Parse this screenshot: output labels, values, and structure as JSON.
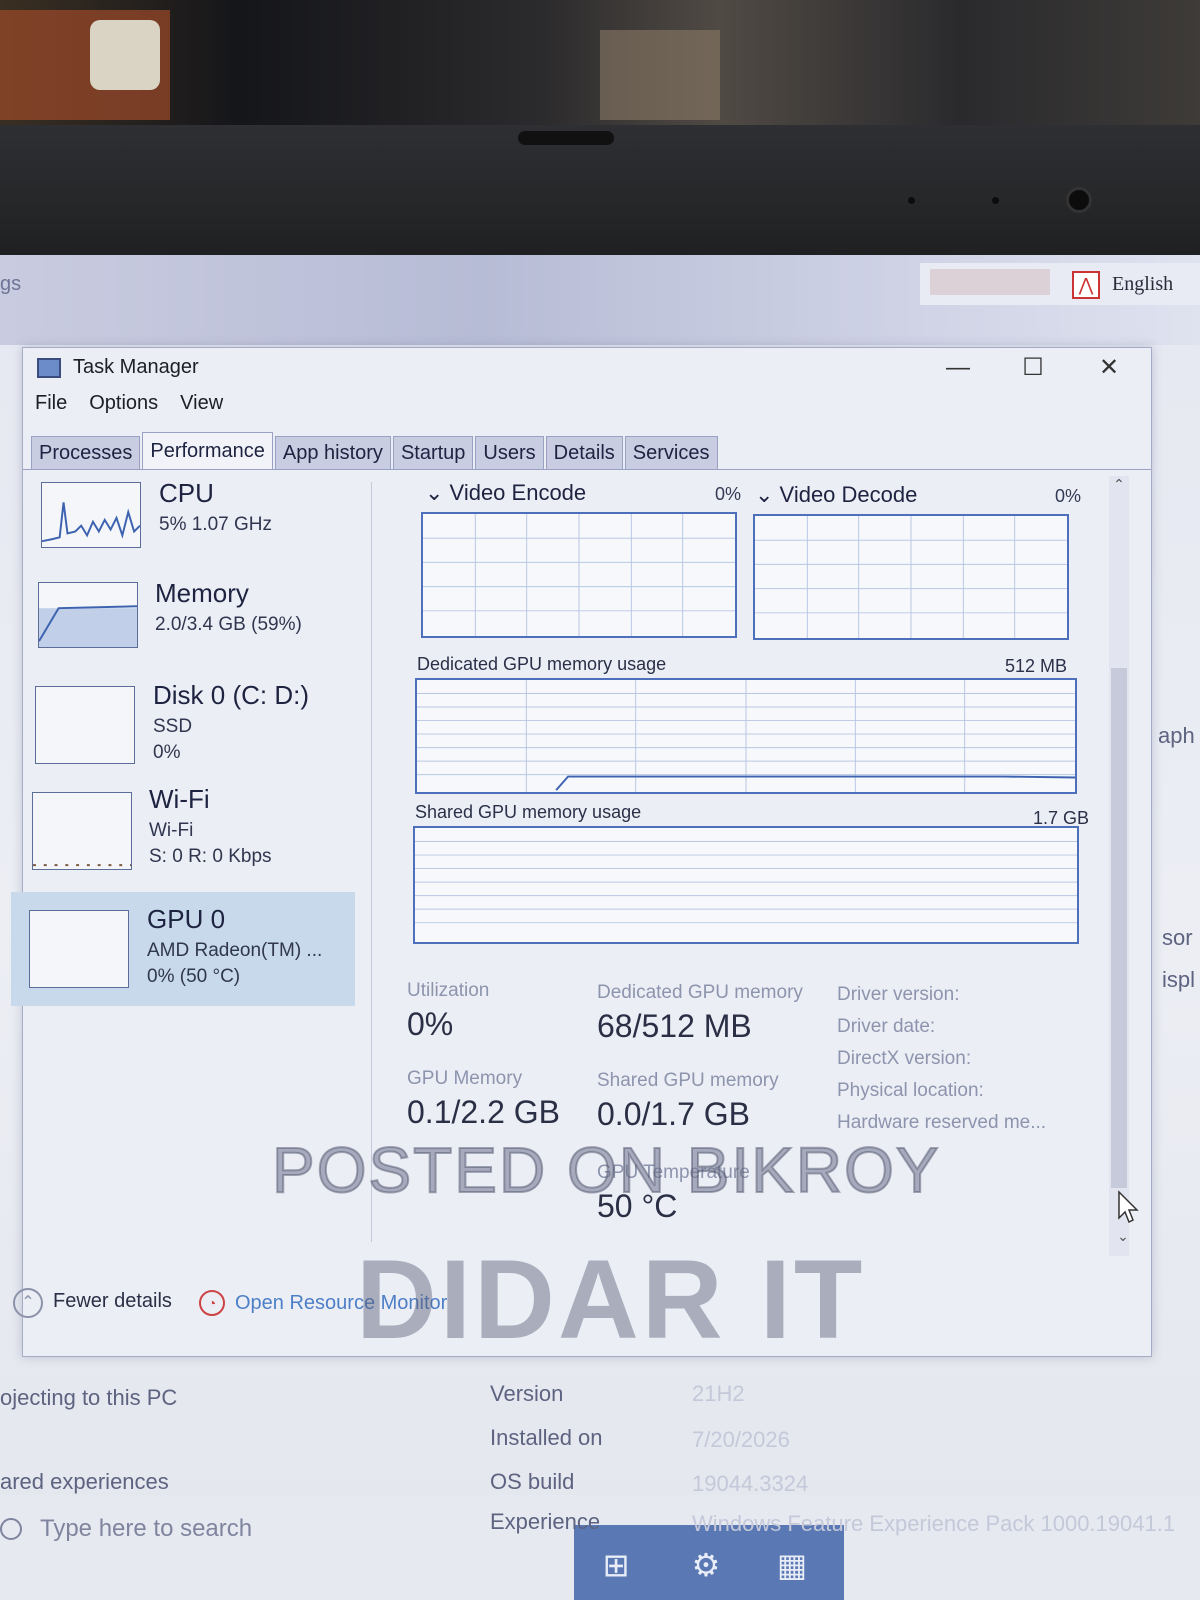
{
  "window": {
    "title": "Task Manager",
    "controls": {
      "minimize": "—",
      "maximize": "☐",
      "close": "✕"
    }
  },
  "menu": [
    "File",
    "Options",
    "View"
  ],
  "tabs": [
    "Processes",
    "Performance",
    "App history",
    "Startup",
    "Users",
    "Details",
    "Services"
  ],
  "active_tab": "Performance",
  "sidebar": [
    {
      "name": "CPU",
      "line1": "5%  1.07 GHz",
      "line2": ""
    },
    {
      "name": "Memory",
      "line1": "2.0/3.4 GB (59%)",
      "line2": ""
    },
    {
      "name": "Disk 0 (C: D:)",
      "line1": "SSD",
      "line2": "0%"
    },
    {
      "name": "Wi-Fi",
      "line1": "Wi-Fi",
      "line2": "S: 0  R: 0 Kbps"
    },
    {
      "name": "GPU 0",
      "line1": "AMD Radeon(TM) ...",
      "line2": "0% (50 °C)"
    }
  ],
  "graphs": {
    "video_encode": {
      "label": "Video Encode",
      "pct": "0%"
    },
    "video_decode": {
      "label": "Video Decode",
      "pct": "0%"
    },
    "dedicated": {
      "label": "Dedicated GPU memory usage",
      "max": "512 MB"
    },
    "shared": {
      "label": "Shared GPU memory usage",
      "max": "1.7 GB"
    }
  },
  "stats": {
    "utilization": {
      "label": "Utilization",
      "value": "0%"
    },
    "dedicated_mem": {
      "label": "Dedicated GPU memory",
      "value": "68/512 MB"
    },
    "gpu_memory": {
      "label": "GPU Memory",
      "value": "0.1/2.2 GB"
    },
    "shared_mem": {
      "label": "Shared GPU memory",
      "value": "0.0/1.7 GB"
    },
    "gpu_temp": {
      "label": "GPU Temperature",
      "value": "50 °C"
    }
  },
  "info_labels": [
    "Driver version:",
    "Driver date:",
    "DirectX version:",
    "Physical location:",
    "Hardware reserved me..."
  ],
  "footer": {
    "fewer": "Fewer details",
    "resource_monitor": "Open Resource Monitor"
  },
  "background": {
    "top_left": "gs",
    "language": "English",
    "side_right_1": "aph",
    "side_right_2": "sor",
    "side_right_3": "ispl",
    "rows_left": [
      "ojecting to this PC",
      "ared experiences"
    ],
    "rows": [
      {
        "label": "Version",
        "value": "21H2"
      },
      {
        "label": "Installed on",
        "value": "7/20/2026"
      },
      {
        "label": "OS build",
        "value": "19044.3324"
      },
      {
        "label": "Experience",
        "value": "Windows Feature Experience Pack 1000.19041.1"
      }
    ],
    "search_placeholder": "Type here to search"
  },
  "watermark": {
    "line1": "POSTED ON BIKROY",
    "line2": "DIDAR IT"
  },
  "colors": {
    "graph_border": "#4e6fb9",
    "selected_item": "#c7d9ea",
    "link": "#4d7fc7"
  }
}
